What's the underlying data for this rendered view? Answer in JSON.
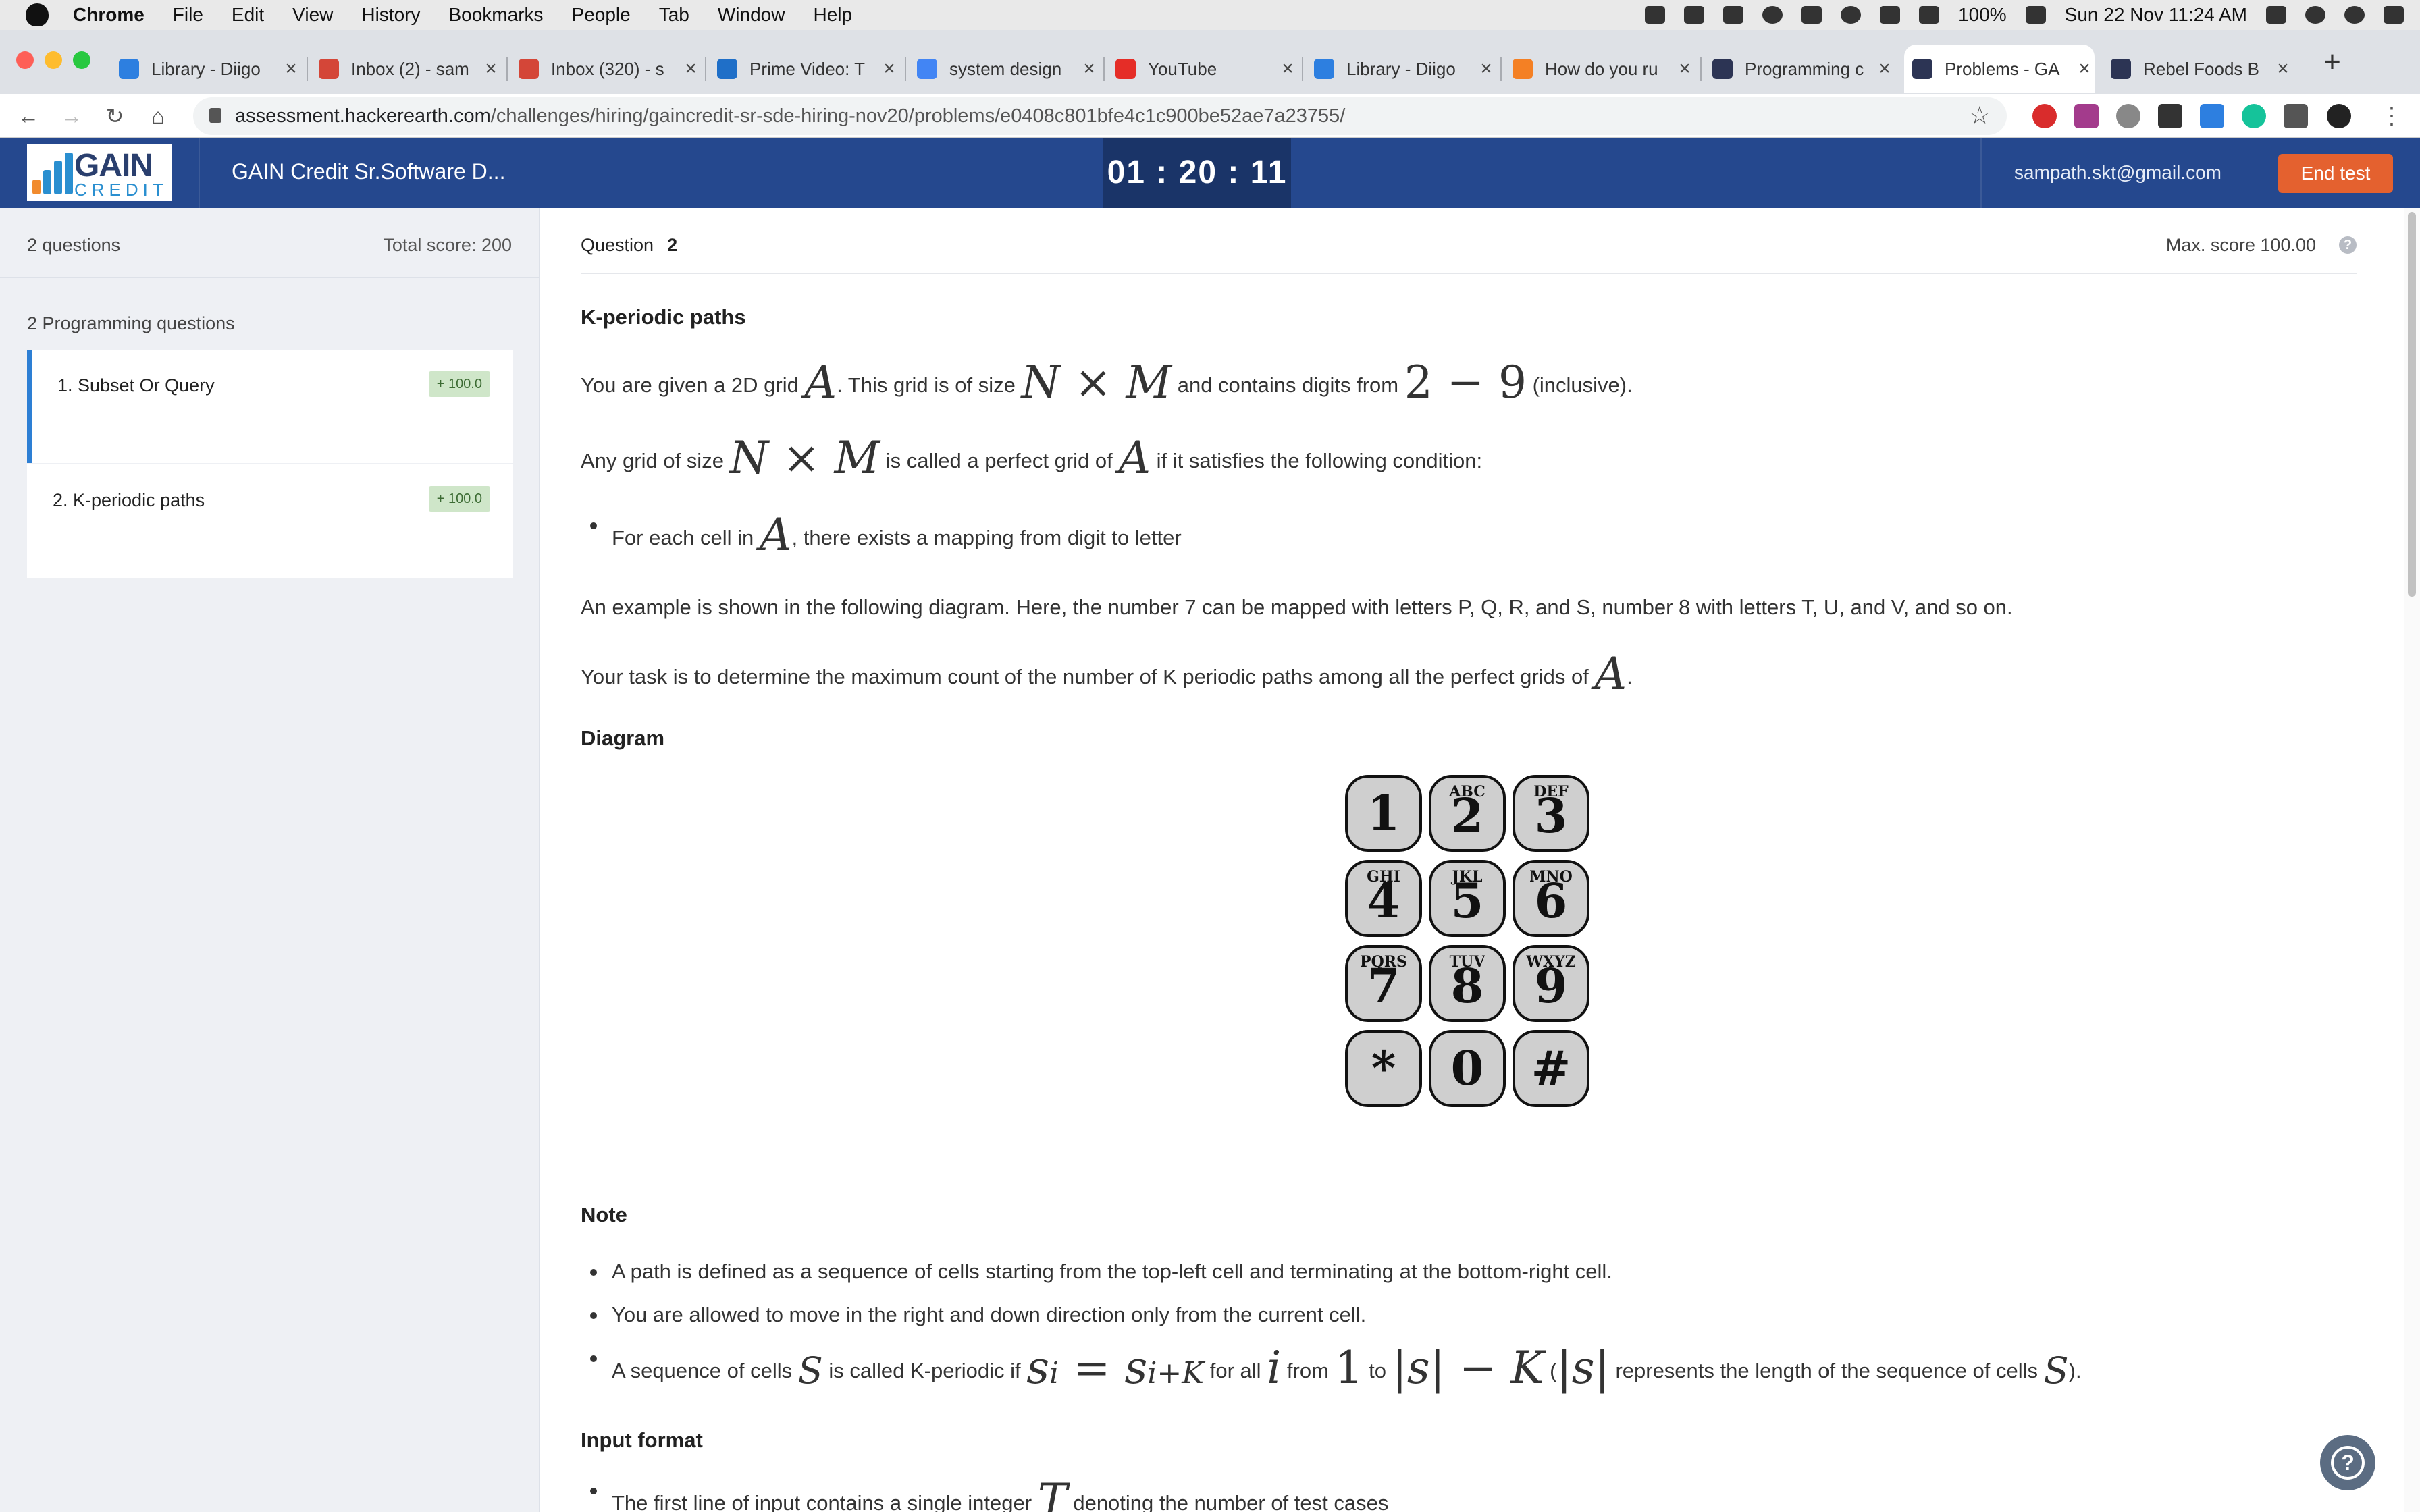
{
  "menubar": {
    "items": [
      "Chrome",
      "File",
      "Edit",
      "View",
      "History",
      "Bookmarks",
      "People",
      "Tab",
      "Window",
      "Help"
    ],
    "battery": "100%",
    "datetime": "Sun 22 Nov  11:24 AM"
  },
  "tabs": [
    {
      "title": "Library - Diigo",
      "icon": "diigo-icon",
      "color": "#2d7fe0"
    },
    {
      "title": "Inbox (2) - sam",
      "icon": "gmail-icon",
      "color": "#d44638"
    },
    {
      "title": "Inbox (320) - s",
      "icon": "gmail-icon",
      "color": "#d44638"
    },
    {
      "title": "Prime Video: T",
      "icon": "prime-video-icon",
      "color": "#1f6fc8"
    },
    {
      "title": "system design",
      "icon": "google-icon",
      "color": "#4285f4"
    },
    {
      "title": "YouTube",
      "icon": "youtube-icon",
      "color": "#e52d27"
    },
    {
      "title": "Library - Diigo",
      "icon": "diigo-icon",
      "color": "#2d7fe0"
    },
    {
      "title": "How do you ru",
      "icon": "stackoverflow-icon",
      "color": "#f48024"
    },
    {
      "title": "Programming c",
      "icon": "hackerearth-icon",
      "color": "#2c3454"
    },
    {
      "title": "Problems - GA",
      "icon": "hackerearth-icon",
      "color": "#2c3454",
      "active": true
    },
    {
      "title": "Rebel Foods B",
      "icon": "hackerearth-icon",
      "color": "#2c3454"
    }
  ],
  "address": {
    "host": "assessment.hackerearth.com",
    "path": "/challenges/hiring/gaincredit-sr-sde-hiring-nov20/problems/e0408c801bfe4c1c900be52ae7a23755/"
  },
  "header": {
    "logo_word1": "GAIN",
    "logo_word2": "CREDIT",
    "test_title": "GAIN Credit Sr.Software D...",
    "timer": "01 : 20 : 11",
    "email": "sampath.skt@gmail.com",
    "end_test": "End test"
  },
  "sidebar": {
    "questions_count": "2 questions",
    "total_score": "Total score: 200",
    "section_title": "2 Programming questions",
    "questions": [
      {
        "label": "1.  Subset Or Query",
        "badge": "+ 100.0"
      },
      {
        "label": "2.  K-periodic paths",
        "badge": "+ 100.0"
      }
    ]
  },
  "question": {
    "label": "Question",
    "number": "2",
    "max_score": "Max. score 100.00",
    "help": "?",
    "title": "K-periodic paths",
    "p1": {
      "a": "You are given a 2D grid ",
      "m1": "A",
      "b": ". This grid is of size ",
      "m2": "N × M",
      "c": " and contains digits from ",
      "m3": "2 − 9",
      "d": " (inclusive)."
    },
    "p2": {
      "a": "Any grid of size ",
      "m1": "N × M",
      "b": " is called a perfect grid of ",
      "m2": "A",
      "c": " if it satisfies the following condition:"
    },
    "b1": {
      "a": "For each cell in ",
      "m1": "A",
      "b": ", there exists a mapping from digit to letter"
    },
    "p3": "An example is shown in the following diagram. Here, the number 7 can be mapped with letters P, Q, R, and S, number 8 with letters T, U, and V, and so on.",
    "p4": {
      "a": "Your task is to determine the maximum count of the number of K periodic paths among all the perfect grids of ",
      "m1": "A",
      "b": "."
    },
    "diagram_heading": "Diagram",
    "keypad": [
      {
        "digit": "1",
        "letters": ""
      },
      {
        "digit": "2",
        "letters": "ABC"
      },
      {
        "digit": "3",
        "letters": "DEF"
      },
      {
        "digit": "4",
        "letters": "GHI"
      },
      {
        "digit": "5",
        "letters": "JKL"
      },
      {
        "digit": "6",
        "letters": "MNO"
      },
      {
        "digit": "7",
        "letters": "PQRS"
      },
      {
        "digit": "8",
        "letters": "TUV"
      },
      {
        "digit": "9",
        "letters": "WXYZ"
      },
      {
        "digit": "*",
        "letters": ""
      },
      {
        "digit": "0",
        "letters": ""
      },
      {
        "digit": "#",
        "letters": ""
      }
    ],
    "note_heading": "Note",
    "notes": {
      "n1": "A path is defined as a sequence of cells starting from the top-left cell and terminating at the bottom-right cell.",
      "n2": "You are allowed to move in the right and down direction only from the current cell.",
      "n3": {
        "a": "A sequence of cells ",
        "m1": "S",
        "b": " is called K-periodic if ",
        "m2": "s",
        "m2s": "i",
        "m3": " = ",
        "m4": "s",
        "m4s": "i+K",
        "c": " for all ",
        "m5": "i",
        "d": " from ",
        "m6": "1",
        "e": " to ",
        "m7": "|s| − K",
        "f": " (",
        "m8": "|s|",
        "g": " represents the length of the sequence of cells ",
        "m9": "S",
        "h": ")."
      }
    },
    "input_heading": "Input format",
    "input_b1": {
      "a": "The first line of input contains a single integer ",
      "m1": "T",
      "b": " denoting the number of test cases"
    }
  }
}
